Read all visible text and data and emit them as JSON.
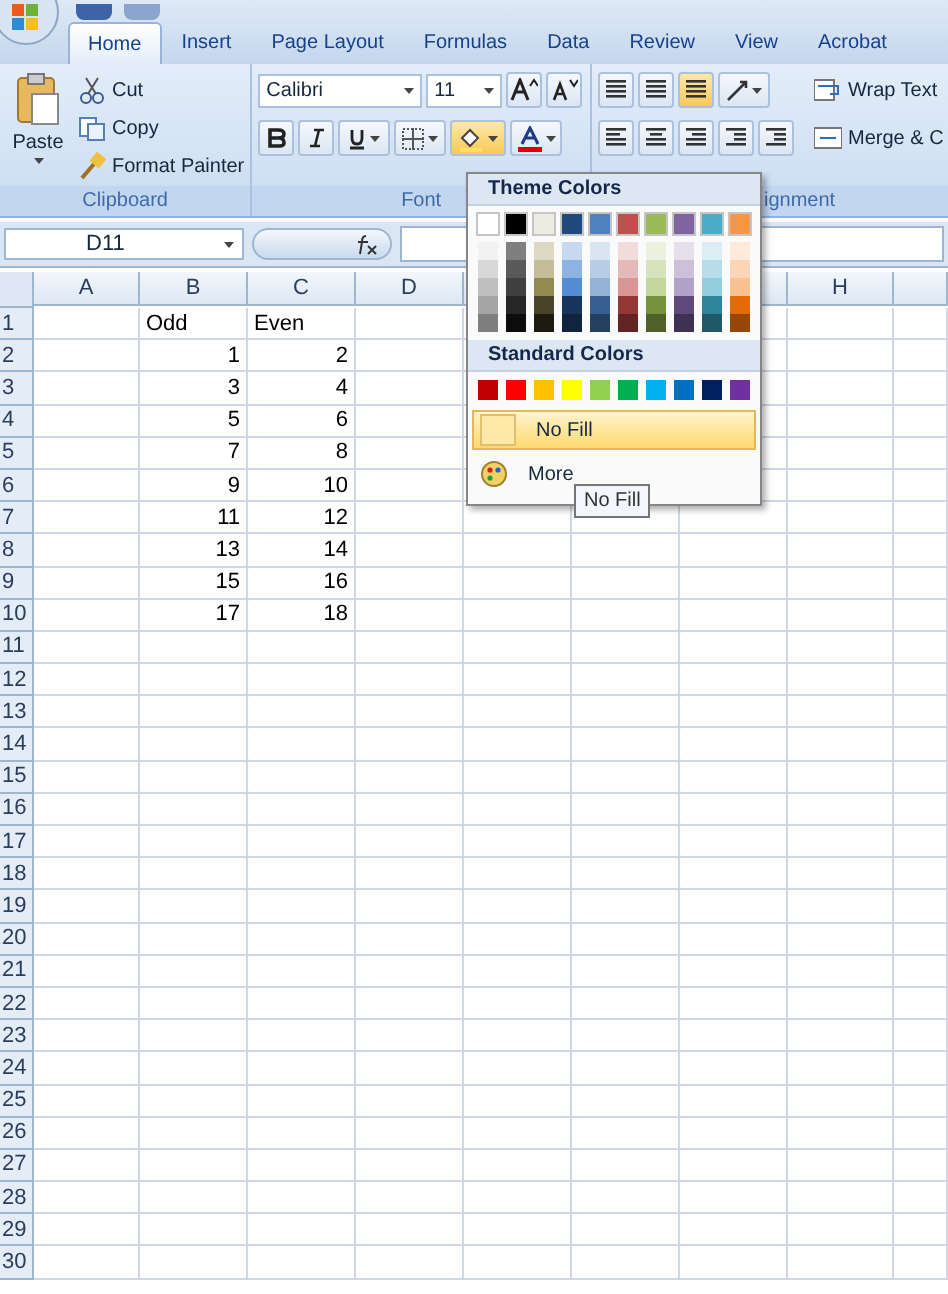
{
  "tabs": [
    {
      "label": "Home",
      "selected": true
    },
    {
      "label": "Insert",
      "selected": false
    },
    {
      "label": "Page Layout",
      "selected": false
    },
    {
      "label": "Formulas",
      "selected": false
    },
    {
      "label": "Data",
      "selected": false
    },
    {
      "label": "Review",
      "selected": false
    },
    {
      "label": "View",
      "selected": false
    },
    {
      "label": "Acrobat",
      "selected": false
    }
  ],
  "ribbon": {
    "clipboard": {
      "label": "Clipboard",
      "paste": "Paste",
      "items": [
        {
          "kind": "cut",
          "label": "Cut"
        },
        {
          "kind": "copy",
          "label": "Copy"
        },
        {
          "kind": "painter",
          "label": "Format Painter"
        }
      ]
    },
    "font": {
      "label": "Font",
      "font_name": "Calibri",
      "font_size": "11",
      "fill_pressed": true
    },
    "alignment": {
      "label": "ignment",
      "vertical": [
        {
          "selected": false
        },
        {
          "selected": false
        },
        {
          "selected": true
        }
      ],
      "wrap_text": "Wrap Text",
      "merge": "Merge & C"
    }
  },
  "formula_bar": {
    "name_box": "D11"
  },
  "sheet": {
    "columns": [
      {
        "label": "A"
      },
      {
        "label": "B"
      },
      {
        "label": "C"
      },
      {
        "label": "D"
      },
      {
        "label": "H"
      }
    ],
    "rows": [
      {
        "label": "1",
        "cells": [
          null,
          {
            "kind": "text",
            "text": "Odd"
          },
          {
            "kind": "text",
            "text": "Even"
          }
        ]
      },
      {
        "label": "2",
        "cells": [
          null,
          {
            "kind": "number",
            "text": "1"
          },
          {
            "kind": "number",
            "text": "2"
          }
        ]
      },
      {
        "label": "3",
        "cells": [
          null,
          {
            "kind": "number",
            "text": "3"
          },
          {
            "kind": "number",
            "text": "4"
          }
        ]
      },
      {
        "label": "4",
        "cells": [
          null,
          {
            "kind": "number",
            "text": "5"
          },
          {
            "kind": "number",
            "text": "6"
          }
        ]
      },
      {
        "label": "5",
        "cells": [
          null,
          {
            "kind": "number",
            "text": "7"
          },
          {
            "kind": "number",
            "text": "8"
          }
        ]
      },
      {
        "label": "6",
        "cells": [
          null,
          {
            "kind": "number",
            "text": "9"
          },
          {
            "kind": "number",
            "text": "10"
          }
        ]
      },
      {
        "label": "7",
        "cells": [
          null,
          {
            "kind": "number",
            "text": "11"
          },
          {
            "kind": "number",
            "text": "12"
          }
        ]
      },
      {
        "label": "8",
        "cells": [
          null,
          {
            "kind": "number",
            "text": "13"
          },
          {
            "kind": "number",
            "text": "14"
          }
        ]
      },
      {
        "label": "9",
        "cells": [
          null,
          {
            "kind": "number",
            "text": "15"
          },
          {
            "kind": "number",
            "text": "16"
          }
        ]
      },
      {
        "label": "10",
        "cells": [
          null,
          {
            "kind": "number",
            "text": "17"
          },
          {
            "kind": "number",
            "text": "18"
          }
        ]
      },
      {
        "label": "11"
      },
      {
        "label": "12"
      },
      {
        "label": "13"
      },
      {
        "label": "14"
      },
      {
        "label": "15"
      },
      {
        "label": "16"
      },
      {
        "label": "17"
      },
      {
        "label": "18"
      },
      {
        "label": "19"
      },
      {
        "label": "20"
      },
      {
        "label": "21"
      },
      {
        "label": "22"
      },
      {
        "label": "23"
      },
      {
        "label": "24"
      },
      {
        "label": "25"
      },
      {
        "label": "26"
      },
      {
        "label": "27"
      },
      {
        "label": "28"
      },
      {
        "label": "29"
      },
      {
        "label": "30"
      }
    ]
  },
  "color_menu": {
    "theme_title": "Theme Colors",
    "theme_colors": [
      {
        "color": "#ffffff",
        "shades": [
          {
            "color": "#f2f2f2"
          },
          {
            "color": "#d8d8d8"
          },
          {
            "color": "#bfbfbf"
          },
          {
            "color": "#a5a5a5"
          },
          {
            "color": "#7f7f7f"
          }
        ]
      },
      {
        "color": "#000000",
        "shades": [
          {
            "color": "#7f7f7f"
          },
          {
            "color": "#595959"
          },
          {
            "color": "#3f3f3f"
          },
          {
            "color": "#262626"
          },
          {
            "color": "#0c0c0c"
          }
        ]
      },
      {
        "color": "#eeece1",
        "shades": [
          {
            "color": "#ddd9c3"
          },
          {
            "color": "#c4bd97"
          },
          {
            "color": "#938953"
          },
          {
            "color": "#494429"
          },
          {
            "color": "#1d1b10"
          }
        ]
      },
      {
        "color": "#1f497d",
        "shades": [
          {
            "color": "#c6d9f0"
          },
          {
            "color": "#8db3e2"
          },
          {
            "color": "#548dd4"
          },
          {
            "color": "#17365d"
          },
          {
            "color": "#0f243e"
          }
        ]
      },
      {
        "color": "#4f81bd",
        "shades": [
          {
            "color": "#dbe5f1"
          },
          {
            "color": "#b8cce4"
          },
          {
            "color": "#95b3d7"
          },
          {
            "color": "#366092"
          },
          {
            "color": "#244061"
          }
        ]
      },
      {
        "color": "#c0504d",
        "shades": [
          {
            "color": "#f2dcdb"
          },
          {
            "color": "#e5b9b7"
          },
          {
            "color": "#d99694"
          },
          {
            "color": "#953734"
          },
          {
            "color": "#632423"
          }
        ]
      },
      {
        "color": "#9bbb59",
        "shades": [
          {
            "color": "#ebf1dd"
          },
          {
            "color": "#d7e3bc"
          },
          {
            "color": "#c3d69b"
          },
          {
            "color": "#76923c"
          },
          {
            "color": "#4f6128"
          }
        ]
      },
      {
        "color": "#8064a2",
        "shades": [
          {
            "color": "#e5e0ec"
          },
          {
            "color": "#ccc1d9"
          },
          {
            "color": "#b2a2c7"
          },
          {
            "color": "#5f497a"
          },
          {
            "color": "#3f3151"
          }
        ]
      },
      {
        "color": "#4bacc6",
        "shades": [
          {
            "color": "#dbeef3"
          },
          {
            "color": "#b7dde8"
          },
          {
            "color": "#92cddc"
          },
          {
            "color": "#31859b"
          },
          {
            "color": "#205867"
          }
        ]
      },
      {
        "color": "#f79646",
        "shades": [
          {
            "color": "#fdeada"
          },
          {
            "color": "#fbd5b5"
          },
          {
            "color": "#fac08f"
          },
          {
            "color": "#e36c09"
          },
          {
            "color": "#974806"
          }
        ]
      }
    ],
    "standard_title": "Standard Colors",
    "standard_colors": [
      {
        "color": "#c00000"
      },
      {
        "color": "#ff0000"
      },
      {
        "color": "#ffc000"
      },
      {
        "color": "#ffff00"
      },
      {
        "color": "#92d050"
      },
      {
        "color": "#00b050"
      },
      {
        "color": "#00b0f0"
      },
      {
        "color": "#0070c0"
      },
      {
        "color": "#002060"
      },
      {
        "color": "#7030a0"
      }
    ],
    "no_fill": {
      "label": "No Fill",
      "highlighted": true
    },
    "more_colors": {
      "label": "More"
    }
  },
  "tooltip": {
    "text": "No Fill"
  }
}
